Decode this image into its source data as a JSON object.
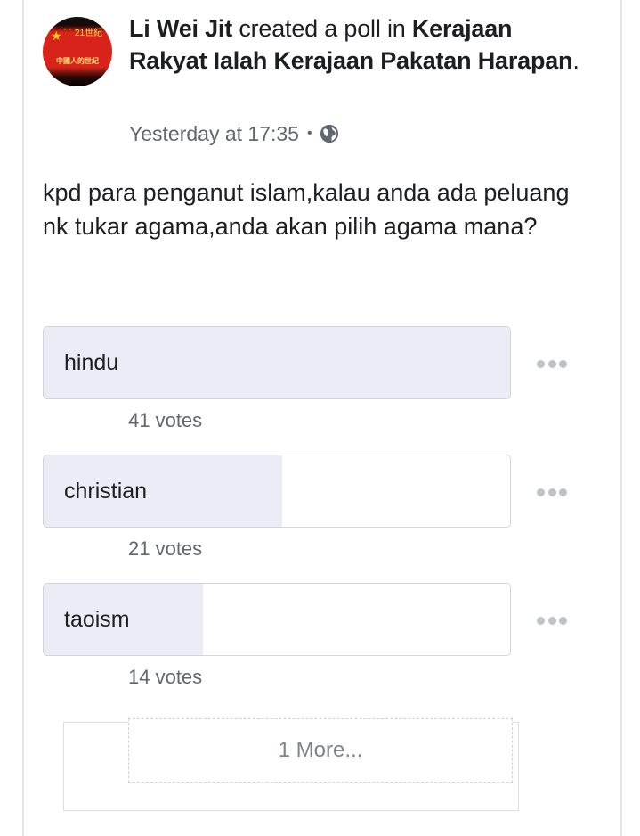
{
  "post": {
    "author": "Li Wei Jit",
    "action_text": " created a poll in ",
    "group_name": "Kerajaan Rakyat Ialah Kerajaan Pakatan Harapan",
    "trailing_period": ".",
    "timestamp": "Yesterday at 17:35",
    "separator": "•",
    "privacy_icon": "globe-icon",
    "avatar": {
      "top_text": "21世紀",
      "bottom_text": "中國人的世紀",
      "star": "★",
      "dots": "• • •",
      "colors": {
        "flag_red": "#d8231a",
        "star_yellow": "#ffd21a"
      }
    }
  },
  "poll": {
    "question": "kpd para penganut islam,kalau anda ada peluang nk tukar agama,anda akan pilih agama mana?",
    "max_votes": 41,
    "options": [
      {
        "label": "hindu",
        "votes": 41,
        "votes_text": "41 votes",
        "share_of_leader": 1.0
      },
      {
        "label": "christian",
        "votes": 21,
        "votes_text": "21 votes",
        "share_of_leader": 0.512
      },
      {
        "label": "taoism",
        "votes": 14,
        "votes_text": "14 votes",
        "share_of_leader": 0.341
      }
    ],
    "more_label": "1 More...",
    "option_menu_icon": "more-horizontal-icon",
    "colors": {
      "fill": "#ebecf5",
      "border": "#d2d4d8",
      "muted_text": "#606770"
    }
  }
}
